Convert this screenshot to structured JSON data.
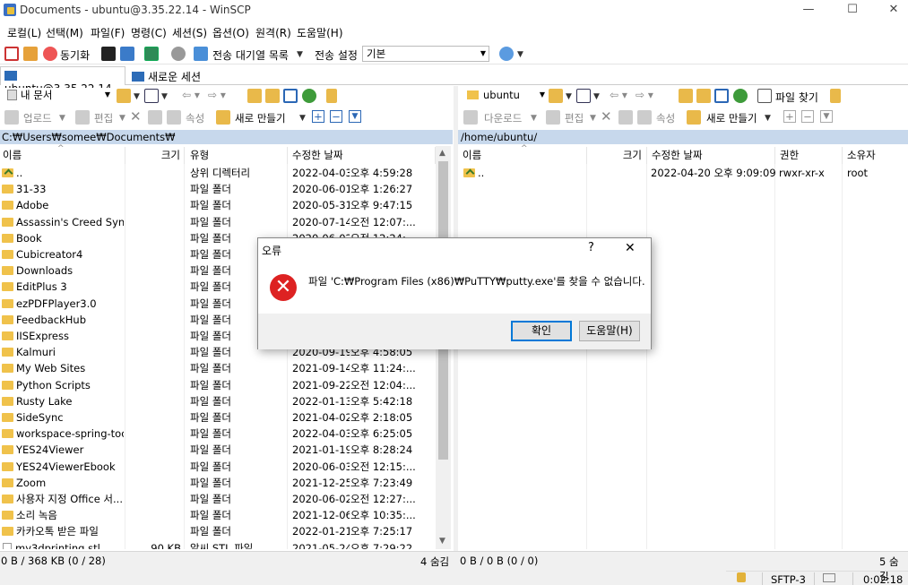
{
  "window": {
    "title": "Documents - ubuntu@3.35.22.14 - WinSCP",
    "minimize": "—",
    "maximize": "☐",
    "close": "✕"
  },
  "menu": [
    "로컬(L)",
    "선택(M)",
    "파일(F)",
    "명령(C)",
    "세션(S)",
    "옵션(O)",
    "원격(R)",
    "도움말(H)"
  ],
  "toolbar": {
    "sync": "동기화",
    "queue": "전송 대기열 목록",
    "transfer_settings_label": "전송 설정",
    "transfer_settings_value": "기본"
  },
  "tabs": {
    "session": "ubuntu@3.35.22.14",
    "session_close": "✕",
    "new_session": "새로운 세션"
  },
  "left": {
    "location": "내 문서",
    "actions": {
      "upload": "업로드",
      "edit": "편집",
      "properties": "속성",
      "new": "새로 만들기"
    },
    "path": "C:₩Users₩somee₩Documents₩",
    "columns": {
      "name": "이름",
      "size": "크기",
      "type": "유형",
      "modified": "수정한 날짜"
    },
    "rows": [
      {
        "name": "..",
        "size": "",
        "type": "상위 디렉터리",
        "date": "2022-04-03",
        "time": "오후 4:59:28",
        "kind": "up"
      },
      {
        "name": "31-33",
        "size": "",
        "type": "파일 폴더",
        "date": "2020-06-01",
        "time": "오후 1:26:27",
        "kind": "folder"
      },
      {
        "name": "Adobe",
        "size": "",
        "type": "파일 폴더",
        "date": "2020-05-31",
        "time": "오후 9:47:15",
        "kind": "folder"
      },
      {
        "name": "Assassin's Creed Synd...",
        "size": "",
        "type": "파일 폴더",
        "date": "2020-07-14",
        "time": "오전 12:07:...",
        "kind": "folder"
      },
      {
        "name": "Book",
        "size": "",
        "type": "파일 폴더",
        "date": "2020-06-02",
        "time": "오전 12:24:...",
        "kind": "folder"
      },
      {
        "name": "Cubicreator4",
        "size": "",
        "type": "파일 폴더",
        "date": "",
        "time": "",
        "kind": "folder"
      },
      {
        "name": "Downloads",
        "size": "",
        "type": "파일 폴더",
        "date": "",
        "time": "",
        "kind": "folder"
      },
      {
        "name": "EditPlus 3",
        "size": "",
        "type": "파일 폴더",
        "date": "",
        "time": "",
        "kind": "folder"
      },
      {
        "name": "ezPDFPlayer3.0",
        "size": "",
        "type": "파일 폴더",
        "date": "",
        "time": "",
        "kind": "folder"
      },
      {
        "name": "FeedbackHub",
        "size": "",
        "type": "파일 폴더",
        "date": "",
        "time": "",
        "kind": "folder"
      },
      {
        "name": "IISExpress",
        "size": "",
        "type": "파일 폴더",
        "date": "",
        "time": "",
        "kind": "folder"
      },
      {
        "name": "Kalmuri",
        "size": "",
        "type": "파일 폴더",
        "date": "2020-09-19",
        "time": "오후 4:58:05",
        "kind": "folder"
      },
      {
        "name": "My Web Sites",
        "size": "",
        "type": "파일 폴더",
        "date": "2021-09-14",
        "time": "오후 11:24:...",
        "kind": "folder"
      },
      {
        "name": "Python Scripts",
        "size": "",
        "type": "파일 폴더",
        "date": "2021-09-22",
        "time": "오전 12:04:...",
        "kind": "folder"
      },
      {
        "name": "Rusty Lake",
        "size": "",
        "type": "파일 폴더",
        "date": "2022-01-13",
        "time": "오후 5:42:18",
        "kind": "folder"
      },
      {
        "name": "SideSync",
        "size": "",
        "type": "파일 폴더",
        "date": "2021-04-02",
        "time": "오후 2:18:05",
        "kind": "folder"
      },
      {
        "name": "workspace-spring-too...",
        "size": "",
        "type": "파일 폴더",
        "date": "2022-04-03",
        "time": "오후 6:25:05",
        "kind": "folder"
      },
      {
        "name": "YES24Viewer",
        "size": "",
        "type": "파일 폴더",
        "date": "2021-01-19",
        "time": "오후 8:28:24",
        "kind": "folder"
      },
      {
        "name": "YES24ViewerEbook",
        "size": "",
        "type": "파일 폴더",
        "date": "2020-06-03",
        "time": "오전 12:15:...",
        "kind": "folder"
      },
      {
        "name": "Zoom",
        "size": "",
        "type": "파일 폴더",
        "date": "2021-12-25",
        "time": "오후 7:23:49",
        "kind": "folder"
      },
      {
        "name": "사용자 지정 Office 서...",
        "size": "",
        "type": "파일 폴더",
        "date": "2020-06-02",
        "time": "오전 12:27:...",
        "kind": "folder"
      },
      {
        "name": "소리 녹음",
        "size": "",
        "type": "파일 폴더",
        "date": "2021-12-06",
        "time": "오후 10:35:...",
        "kind": "folder"
      },
      {
        "name": "카카오톡 받은 파일",
        "size": "",
        "type": "파일 폴더",
        "date": "2022-01-21",
        "time": "오후 7:25:17",
        "kind": "folder"
      },
      {
        "name": "my3dprinting.stl",
        "size": "90 KB",
        "type": "알씨 STL 파일",
        "date": "2021-05-24",
        "time": "오후 7:29:22",
        "kind": "file"
      }
    ],
    "status": "0 B / 368 KB (0 / 28)",
    "hidden": "4 숨김"
  },
  "right": {
    "location": "ubuntu",
    "find": "파일 찾기",
    "actions": {
      "download": "다운로드",
      "edit": "편집",
      "properties": "속성",
      "new": "새로 만들기"
    },
    "path": "/home/ubuntu/",
    "columns": {
      "name": "이름",
      "size": "크기",
      "modified": "수정한 날짜",
      "rights": "권한",
      "owner": "소유자"
    },
    "rows": [
      {
        "name": "..",
        "size": "",
        "date": "2022-04-20 오후 9:09:09",
        "rights": "rwxr-xr-x",
        "owner": "root"
      }
    ],
    "status": "0 B / 0 B (0 / 0)",
    "hidden": "5 숨김"
  },
  "statusbar": {
    "protocol": "SFTP-3",
    "time": "0:02:18"
  },
  "dialog": {
    "title": "오류",
    "help_q": "?",
    "close": "✕",
    "icon": "✕",
    "message": "파일 'C:₩Program Files (x86)₩PuTTY₩putty.exe'를 찾을 수 없습니다.",
    "ok": "확인",
    "help": "도움말(H)"
  },
  "colors": {
    "path_bar": "#c7d8ec",
    "error_red": "#dd2222",
    "dialog_accent": "#0078d7"
  }
}
